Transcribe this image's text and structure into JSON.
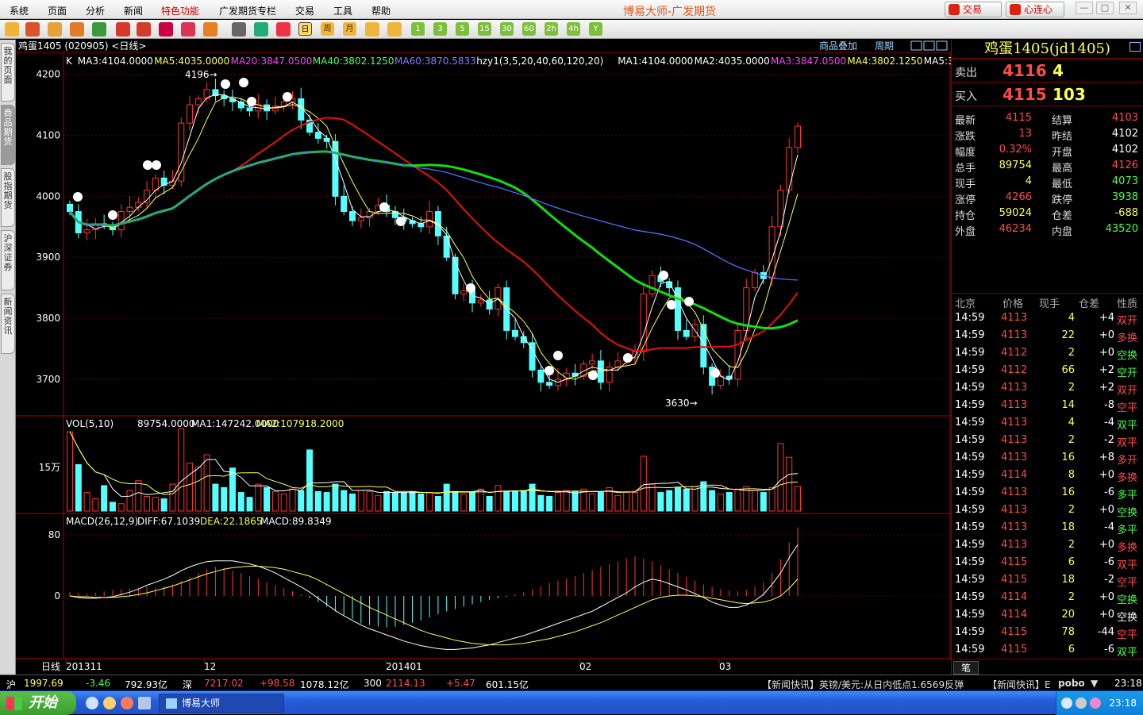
{
  "menu": {
    "items": [
      "系统",
      "页面",
      "分析",
      "新闻",
      "特色功能",
      "广发期货专栏",
      "交易",
      "工具",
      "帮助"
    ],
    "highlight": "特色功能"
  },
  "app_title": "博易大师-广发期货",
  "top_buttons": {
    "trade": "交易",
    "xinlianxin": "心连心"
  },
  "toolbar": {
    "periods": [
      "日",
      "周",
      "月"
    ],
    "minutes": [
      "1",
      "3",
      "5",
      "15",
      "30",
      "60",
      "2h",
      "4h",
      "Y"
    ]
  },
  "left_tabs": [
    "我的页面",
    "商品期货",
    "股指期货",
    "沪深证券",
    "新闻资讯"
  ],
  "chart": {
    "header": "鸡蛋1405 (020905) <日线>",
    "links": [
      "商品叠加",
      "周期"
    ],
    "ma_labels": [
      {
        "text": "K",
        "color": "#ffffff"
      },
      {
        "text": "MA3:4104.0000",
        "color": "#ffffff"
      },
      {
        "text": "MA5:4035.0000",
        "color": "#ffff54"
      },
      {
        "text": "MA20:3847.0500",
        "color": "#ff40ff"
      },
      {
        "text": "MA40:3802.1250",
        "color": "#54ff54"
      },
      {
        "text": "MA60:3870.5833",
        "color": "#8080ff"
      },
      {
        "text": "hzy1(3,5,20,40,60,120,20)",
        "color": "#ffffff"
      },
      {
        "text": "MA1:4104.0000",
        "color": "#ffffff"
      },
      {
        "text": "MA2:4035.0000",
        "color": "#ffffff"
      },
      {
        "text": "MA3:3847.0500",
        "color": "#ff40ff"
      },
      {
        "text": "MA4:3802.1250",
        "color": "#ffff54"
      },
      {
        "text": "MA5:3870.5833",
        "color": "#ffffff"
      }
    ],
    "price_axis": [
      "4200",
      "4100",
      "4000",
      "3900",
      "3800",
      "3700"
    ],
    "annotations": {
      "high": "4196",
      "low": "3630"
    },
    "vol_label": "VOL(5,10)",
    "vol_value": "89754.0000",
    "vol_ma1": "MA1:147242.0000",
    "vol_ma2": "MA2:107918.2000",
    "vol_axis": "15万",
    "macd_label": "MACD(26,12,9)",
    "macd_diff": "DIFF:67.1039",
    "macd_dea": "DEA:22.1865",
    "macd_val": "MACD:89.8349",
    "macd_axis": [
      "80",
      "0"
    ],
    "period_label": "日线",
    "x_labels": [
      "201311",
      "12",
      "201401",
      "02",
      "03"
    ],
    "colors": {
      "up": "#ff3232",
      "down": "#54ffff",
      "ma20": "#e81010",
      "ma40": "#10e010",
      "ma60": "#4d6eff"
    }
  },
  "chart_data": {
    "type": "candlestick",
    "close_start": 3975,
    "closes": [
      3975,
      3940,
      3945,
      3955,
      3952,
      3945,
      3975,
      3982,
      3990,
      4010,
      4030,
      4018,
      4025,
      4120,
      4150,
      4160,
      4175,
      4165,
      4160,
      4155,
      4145,
      4140,
      4150,
      4140,
      4148,
      4155,
      4160,
      4125,
      4105,
      4095,
      4090,
      4000,
      3975,
      3960,
      3965,
      3975,
      3985,
      3975,
      3965,
      3960,
      3955,
      3950,
      3975,
      3935,
      3900,
      3840,
      3845,
      3825,
      3830,
      3815,
      3850,
      3780,
      3770,
      3760,
      3715,
      3695,
      3690,
      3700,
      3710,
      3705,
      3725,
      3730,
      3695,
      3720,
      3730,
      3735,
      3745,
      3840,
      3870,
      3860,
      3850,
      3780,
      3770,
      3790,
      3720,
      3690,
      3705,
      3700,
      3780,
      3850,
      3875,
      3865,
      3950,
      4010,
      4080,
      4115
    ],
    "volumes": [
      162,
      95,
      38,
      25,
      52,
      18,
      15,
      42,
      62,
      30,
      28,
      25,
      55,
      168,
      98,
      90,
      115,
      55,
      48,
      88,
      38,
      28,
      55,
      48,
      40,
      35,
      45,
      42,
      125,
      40,
      38,
      55,
      42,
      35,
      42,
      40,
      32,
      40,
      38,
      38,
      40,
      35,
      38,
      30,
      55,
      40,
      35,
      38,
      45,
      30,
      52,
      40,
      40,
      42,
      55,
      32,
      30,
      38,
      42,
      40,
      45,
      35,
      38,
      48,
      32,
      40,
      38,
      112,
      55,
      38,
      42,
      48,
      45,
      50,
      60,
      42,
      35,
      38,
      45,
      50,
      42,
      38,
      48,
      138,
      110,
      50
    ],
    "macd_hist": [
      5,
      4,
      3,
      4,
      6,
      8,
      9,
      10,
      11,
      12,
      11,
      13,
      15,
      20,
      25,
      30,
      35,
      38,
      37,
      33,
      30,
      26,
      23,
      18,
      14,
      10,
      6,
      2,
      -3,
      -8,
      -14,
      -20,
      -25,
      -30,
      -36,
      -38,
      -40,
      -41,
      -40,
      -38,
      -35,
      -32,
      -28,
      -24,
      -20,
      -17,
      -14,
      -11,
      -8,
      -5,
      -3,
      -1,
      2,
      5,
      9,
      13,
      17,
      20,
      23,
      26,
      30,
      34,
      38,
      42,
      45,
      49,
      52,
      49,
      45,
      40,
      35,
      30,
      25,
      20,
      15,
      12,
      9,
      7,
      6,
      8,
      12,
      18,
      30,
      48,
      70,
      89.8
    ],
    "diff": [
      0,
      -2,
      -3,
      -3,
      -2,
      -1,
      2,
      5,
      9,
      14,
      18,
      22,
      27,
      33,
      38,
      42,
      45,
      46,
      46,
      46,
      44,
      42,
      39,
      35,
      30,
      24,
      18,
      12,
      5,
      -3,
      -11,
      -19,
      -26,
      -32,
      -38,
      -43,
      -47,
      -51,
      -55,
      -59,
      -62,
      -65,
      -67,
      -69,
      -70,
      -70,
      -69,
      -68,
      -66,
      -64,
      -61,
      -58,
      -55,
      -52,
      -48,
      -44,
      -40,
      -36,
      -32,
      -28,
      -24,
      -20,
      -14,
      -8,
      -2,
      4,
      12,
      18,
      22,
      20,
      16,
      12,
      8,
      3,
      -2,
      -8,
      -12,
      -15,
      -15,
      -12,
      -6,
      2,
      15,
      30,
      50,
      67.1
    ],
    "dea": [
      0,
      -1,
      -1,
      -2,
      -2,
      -2,
      -1,
      0,
      2,
      4,
      7,
      10,
      13,
      17,
      21,
      25,
      29,
      32,
      35,
      37,
      38,
      39,
      39,
      38,
      37,
      35,
      32,
      29,
      26,
      21,
      15,
      9,
      3,
      -3,
      -9,
      -15,
      -20,
      -25,
      -30,
      -35,
      -40,
      -45,
      -49,
      -52,
      -55,
      -58,
      -60,
      -62,
      -63,
      -64,
      -64,
      -64,
      -63,
      -62,
      -60,
      -58,
      -56,
      -53,
      -50,
      -47,
      -43,
      -39,
      -35,
      -30,
      -25,
      -20,
      -15,
      -10,
      -5,
      -2,
      0,
      1,
      1,
      0,
      -1,
      -3,
      -5,
      -7,
      -9,
      -10,
      -9,
      -8,
      -5,
      0,
      10,
      22.2
    ],
    "ylim": [
      3640,
      4210
    ],
    "high": 4196,
    "low": 3630,
    "last_close": 4115
  },
  "quote": {
    "title": "鸡蛋1405(jd1405)",
    "sell": {
      "label": "卖出",
      "price": "4116",
      "vol": "4"
    },
    "buy": {
      "label": "买入",
      "price": "4115",
      "vol": "103"
    },
    "stats": [
      [
        {
          "l": "最新",
          "v": "4115",
          "c": "up"
        },
        {
          "l": "结算",
          "v": "4103",
          "c": "up"
        }
      ],
      [
        {
          "l": "涨跌",
          "v": "13",
          "c": "up"
        },
        {
          "l": "昨结",
          "v": "4102",
          "c": "wh"
        }
      ],
      [
        {
          "l": "幅度",
          "v": "0.32%",
          "c": "up"
        },
        {
          "l": "开盘",
          "v": "4102",
          "c": "wh"
        }
      ],
      [
        {
          "l": "总手",
          "v": "89754",
          "c": "ye"
        },
        {
          "l": "最高",
          "v": "4126",
          "c": "up"
        }
      ],
      [
        {
          "l": "现手",
          "v": "4",
          "c": "ye"
        },
        {
          "l": "最低",
          "v": "4073",
          "c": "dn"
        }
      ],
      [
        {
          "l": "涨停",
          "v": "4266",
          "c": "up"
        },
        {
          "l": "跌停",
          "v": "3938",
          "c": "dn"
        }
      ],
      [
        {
          "l": "持仓",
          "v": "59024",
          "c": "ye"
        },
        {
          "l": "仓差",
          "v": "-688",
          "c": "ye"
        }
      ],
      [
        {
          "l": "外盘",
          "v": "46234",
          "c": "up"
        },
        {
          "l": "内盘",
          "v": "43520",
          "c": "dn"
        }
      ]
    ],
    "tick_header": [
      "北京",
      "价格",
      "现手",
      "仓差",
      "性质"
    ],
    "ticks": [
      [
        "14:59",
        "4113",
        "4",
        "+4",
        "双开",
        "up"
      ],
      [
        "14:59",
        "4113",
        "22",
        "+0",
        "多换",
        "up"
      ],
      [
        "14:59",
        "4112",
        "2",
        "+0",
        "空换",
        "dn"
      ],
      [
        "14:59",
        "4112",
        "66",
        "+2",
        "空开",
        "dn"
      ],
      [
        "14:59",
        "4113",
        "2",
        "+2",
        "双开",
        "up"
      ],
      [
        "14:59",
        "4113",
        "14",
        "-8",
        "空平",
        "up"
      ],
      [
        "14:59",
        "4113",
        "4",
        "-4",
        "双平",
        "dn"
      ],
      [
        "14:59",
        "4113",
        "2",
        "-2",
        "双平",
        "up"
      ],
      [
        "14:59",
        "4113",
        "16",
        "+8",
        "多开",
        "up"
      ],
      [
        "14:59",
        "4114",
        "8",
        "+0",
        "多换",
        "up"
      ],
      [
        "14:59",
        "4113",
        "16",
        "-6",
        "多平",
        "dn"
      ],
      [
        "14:59",
        "4113",
        "2",
        "+0",
        "空换",
        "dn"
      ],
      [
        "14:59",
        "4113",
        "18",
        "-4",
        "多平",
        "dn"
      ],
      [
        "14:59",
        "4113",
        "2",
        "+0",
        "多换",
        "up"
      ],
      [
        "14:59",
        "4115",
        "6",
        "-6",
        "双平",
        "up"
      ],
      [
        "14:59",
        "4115",
        "18",
        "-2",
        "空平",
        "up"
      ],
      [
        "14:59",
        "4114",
        "2",
        "+0",
        "空换",
        "dn"
      ],
      [
        "14:59",
        "4114",
        "20",
        "+0",
        "空换",
        "wh"
      ],
      [
        "14:59",
        "4115",
        "78",
        "-44",
        "空平",
        "up"
      ],
      [
        "14:59",
        "4115",
        "6",
        "-6",
        "双平",
        "dn"
      ],
      [
        "14:59",
        "4115",
        "4",
        "+0",
        "空换",
        "dn"
      ],
      [
        "14:59",
        "4115",
        "2",
        "+0",
        "空换",
        "dn"
      ],
      [
        "14:59",
        "4115",
        "4",
        "-4",
        "双平",
        "dn"
      ]
    ],
    "foot_tab": "笔"
  },
  "status": {
    "sh_label": "沪",
    "sh_val": "1997.69",
    "sh_chg": "-3.46",
    "sh_amt": "792.93亿",
    "sz_label": "深",
    "sz_val": "7217.02",
    "sz_chg": "+98.58",
    "sz_amt": "1078.12亿",
    "i300_label": "300",
    "i300_val": "2114.13",
    "i300_chg": "+5.47",
    "i300_amt": "601.15亿",
    "news1": "【新闻快讯】英镑/美元:从日内低点1.6569反弹",
    "news2": "【新闻快讯】E",
    "brand": "pobo",
    "time": "23:18"
  },
  "taskbar": {
    "start": "开始",
    "task": "博易大师",
    "time": "23:18"
  }
}
